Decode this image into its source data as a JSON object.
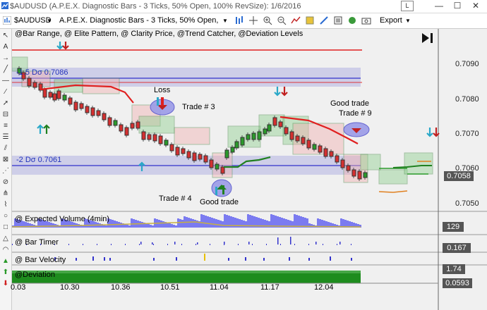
{
  "window": {
    "title": "$AUDUSD (A.P.E.X. Diagnostic Bars - 3 Ticks, 50% Open, 100% RevSize): 1/6/2016",
    "link_label": "L",
    "minimize_label": "—",
    "maximize_label": "☐",
    "close_label": "✕"
  },
  "toolbar": {
    "symbol": "$AUDUSD",
    "bar_type": "A.P.E.X. Diagnostic Bars - 3 Ticks, 50% Open, 100% RevSize",
    "export_label": "Export"
  },
  "chart": {
    "indicators_label": "@Bar Range, @ Elite Pattern, @ Clarity Price, @Trend Catcher, @Deviation Levels",
    "dev_upper": "-1.5 Dσ 0.7086",
    "dev_lower": "-2 Dσ 0.7061",
    "price_ticks": [
      "0.7090",
      "0.7080",
      "0.7070",
      "0.7060",
      "0.7050"
    ],
    "current_price": "0.7058",
    "annotations": {
      "loss": "Loss",
      "trade3": "Trade # 3",
      "good_trade_9a": "Good trade",
      "good_trade_9b": "Trade # 9",
      "trade4": "Trade # 4",
      "good_trade": "Good trade"
    }
  },
  "panels": {
    "expected_volume": {
      "title": "@ Expected Volume (4min)",
      "value": "129"
    },
    "bar_timer": {
      "title": "@ Bar Timer",
      "value": "0.167"
    },
    "bar_velocity": {
      "title": "@ Bar Velocity",
      "value": "1.74"
    },
    "deviation": {
      "title": "@Deviation",
      "value": "0.0593"
    }
  },
  "time_axis": [
    "0.03",
    "10.30",
    "10.36",
    "10.51",
    "11.04",
    "11.17",
    "12.04"
  ],
  "colors": {
    "resistance": "#e02020",
    "dev_line": "#3333cc",
    "dev_band": "#c8c8e6",
    "trend_down": "#e02020",
    "trend_up": "#208020",
    "volume": "#7b7bf0",
    "deviation_bar": "#1e8c1e"
  }
}
